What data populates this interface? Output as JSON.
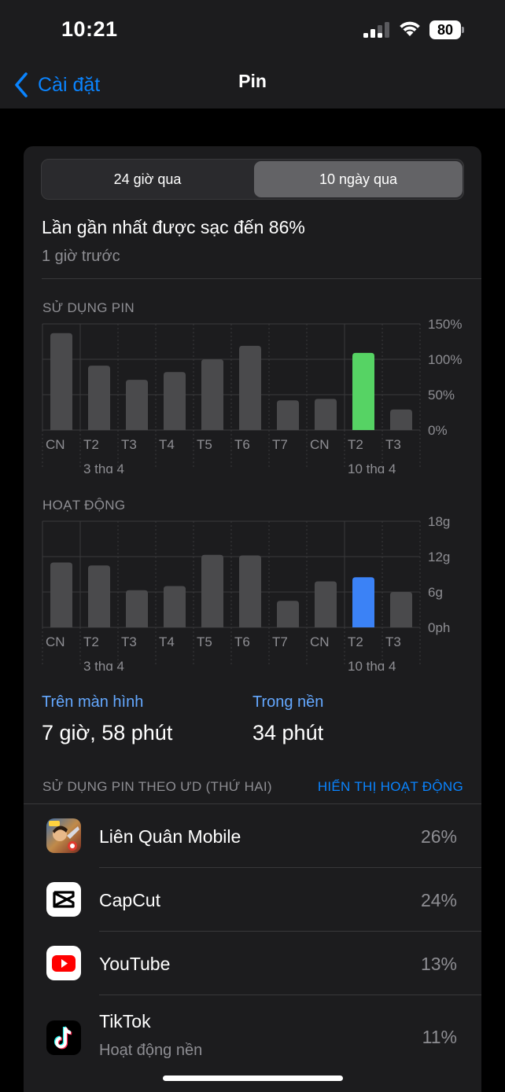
{
  "status_bar": {
    "time": "10:21",
    "battery_level": "80"
  },
  "nav": {
    "back_label": "Cài đặt",
    "title": "Pin"
  },
  "segment": {
    "options": [
      "24 giờ qua",
      "10 ngày qua"
    ],
    "selected": "10 ngày qua"
  },
  "last_charge": {
    "title": "Lần gần nhất được sạc đến 86%",
    "subtitle": "1 giờ trước"
  },
  "battery_usage_chart": {
    "label": "SỬ DỤNG PIN",
    "type": "bar",
    "categories": [
      "CN",
      "T2",
      "T3",
      "T4",
      "T5",
      "T6",
      "T7",
      "CN",
      "T2",
      "T3"
    ],
    "week_labels": [
      "3 thg 4",
      "10 thg 4"
    ],
    "y_ticks": [
      "150%",
      "100%",
      "50%",
      "0%"
    ],
    "ylim": [
      0,
      150
    ],
    "values": [
      137,
      91,
      71,
      82,
      100,
      119,
      42,
      44,
      109,
      29
    ],
    "highlight_index": 8,
    "bar_color": "#4a4a4c",
    "highlight_color": "#56d364"
  },
  "activity_chart": {
    "label": "HOẠT ĐỘNG",
    "type": "bar",
    "categories": [
      "CN",
      "T2",
      "T3",
      "T4",
      "T5",
      "T6",
      "T7",
      "CN",
      "T2",
      "T3"
    ],
    "week_labels": [
      "3 thg 4",
      "10 thg 4"
    ],
    "y_ticks": [
      "18g",
      "12g",
      "6g",
      "0ph"
    ],
    "ylim": [
      0,
      18
    ],
    "unit": "hours",
    "values": [
      11,
      10.5,
      6.3,
      7,
      12.3,
      12.2,
      4.5,
      7.8,
      8.5,
      6
    ],
    "highlight_index": 8,
    "bar_color": "#4a4a4c",
    "highlight_color": "#3b82f6"
  },
  "chart_data": [
    {
      "type": "bar",
      "title": "SỬ DỤNG PIN",
      "categories": [
        "CN",
        "T2",
        "T3",
        "T4",
        "T5",
        "T6",
        "T7",
        "CN",
        "T2",
        "T3"
      ],
      "values": [
        137,
        91,
        71,
        82,
        100,
        119,
        42,
        44,
        109,
        29
      ],
      "ylim": [
        0,
        150
      ],
      "unit": "%"
    },
    {
      "type": "bar",
      "title": "HOẠT ĐỘNG",
      "categories": [
        "CN",
        "T2",
        "T3",
        "T4",
        "T5",
        "T6",
        "T7",
        "CN",
        "T2",
        "T3"
      ],
      "values": [
        11,
        10.5,
        6.3,
        7,
        12.3,
        12.2,
        4.5,
        7.8,
        8.5,
        6
      ],
      "ylim": [
        0,
        18
      ],
      "unit": "hours"
    }
  ],
  "screen_time": {
    "on_screen": {
      "label": "Trên màn hình",
      "value": "7 giờ, 58 phút"
    },
    "background": {
      "label": "Trong nền",
      "value": "34 phút"
    }
  },
  "apps_section": {
    "header": "SỬ DỤNG PIN THEO ƯD (THỨ HAI)",
    "toggle_label": "HIỂN THỊ HOẠT ĐỘNG",
    "apps": [
      {
        "name": "Liên Quân Mobile",
        "percent": "26%",
        "icon": "lienquan-icon"
      },
      {
        "name": "CapCut",
        "percent": "24%",
        "icon": "capcut-icon"
      },
      {
        "name": "YouTube",
        "percent": "13%",
        "icon": "youtube-icon"
      },
      {
        "name": "TikTok",
        "subtitle": "Hoạt động nền",
        "percent": "11%",
        "icon": "tiktok-icon"
      }
    ]
  }
}
